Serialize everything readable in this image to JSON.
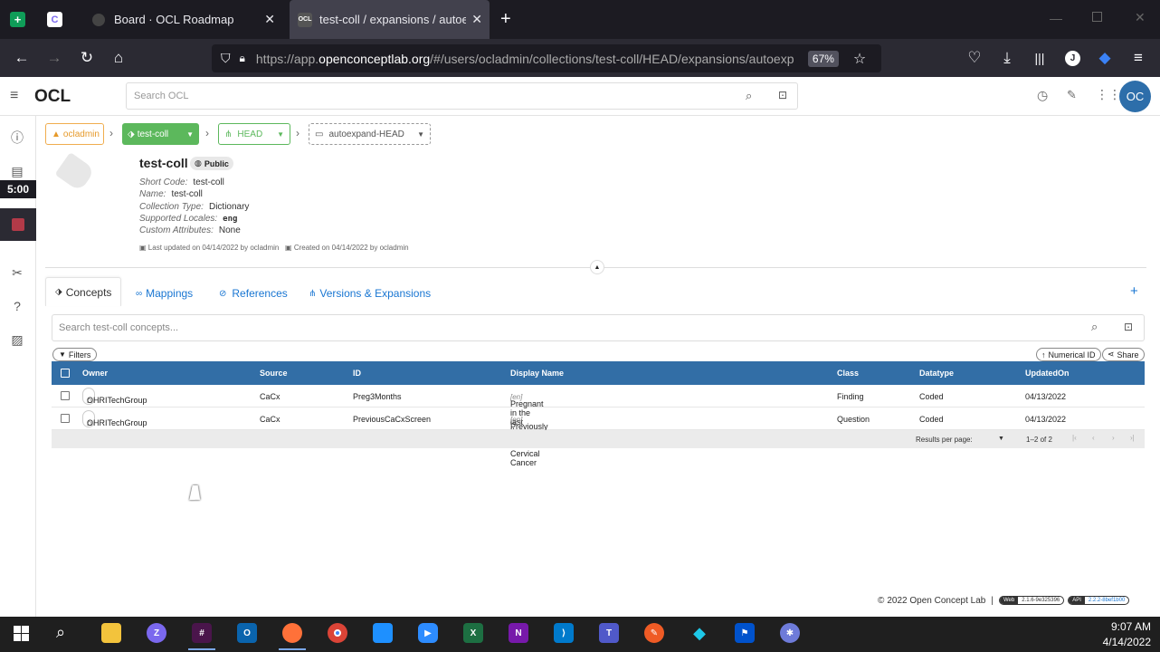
{
  "browser": {
    "tabs": [
      {
        "label": "Board · OCL Roadmap"
      },
      {
        "label": "test-coll / expansions / autoexp"
      }
    ],
    "url_prefix": "https://app.",
    "url_domain": "openconceptlab.org",
    "url_path": "/#/users/ocladmin/collections/test-coll/HEAD/expansions/autoexp",
    "zoom": "67%",
    "profile_initial": "J"
  },
  "app": {
    "logo": "OCL",
    "search_placeholder": "Search OCL",
    "avatar": "OC"
  },
  "timer": "5:00",
  "breadcrumb": {
    "owner": "ocladmin",
    "collection": "test-coll",
    "version": "HEAD",
    "expansion": "autoexpand-HEAD"
  },
  "collection": {
    "title": "test-coll",
    "visibility": "Public",
    "fields": [
      {
        "label": "Short Code:",
        "value": "test-coll"
      },
      {
        "label": "Name:",
        "value": "test-coll"
      },
      {
        "label": "Collection Type:",
        "value": "Dictionary"
      },
      {
        "label": "Supported Locales:",
        "value": "eng"
      },
      {
        "label": "Custom Attributes:",
        "value": "None"
      }
    ],
    "last_updated": "Last updated on 04/14/2022 by ocladmin",
    "created": "Created on 04/14/2022 by ocladmin"
  },
  "tabs": [
    {
      "label": "Concepts"
    },
    {
      "label": "Mappings"
    },
    {
      "label": "References"
    },
    {
      "label": "Versions & Expansions"
    }
  ],
  "concept_search_placeholder": "Search test-coll concepts...",
  "buttons": {
    "filters": "Filters",
    "numerical_id": "Numerical ID",
    "share": "Share"
  },
  "table": {
    "headers": [
      "Owner",
      "Source",
      "ID",
      "Display Name",
      "Class",
      "Datatype",
      "UpdatedOn"
    ],
    "rows": [
      {
        "owner": "OHRITechGroup",
        "source": "CaCx",
        "id": "Preg3Months",
        "name": "Pregnant in the last three months",
        "locale": "[en]",
        "class": "Finding",
        "datatype": "Coded",
        "updated": "04/13/2022"
      },
      {
        "owner": "OHRITechGroup",
        "source": "CaCx",
        "id": "PreviousCaCxScreen",
        "name": "Previously Screened for Cervical Cancer",
        "locale": "[en]",
        "class": "Question",
        "datatype": "Coded",
        "updated": "04/13/2022"
      }
    ],
    "results_per_page": "Results per page:",
    "range": "1–2 of 2"
  },
  "footer": {
    "copyright": "2022 Open Concept Lab",
    "web_label": "Web",
    "web_version": "2.1.6-9e325396",
    "api_label": "API",
    "api_version": "2.2.2-8bef1b00"
  },
  "taskbar": {
    "time": "9:07 AM",
    "date": "4/14/2022"
  },
  "colors": {
    "owner_chip": "#f0ad4e",
    "collection_chip": "#5cb85c",
    "table_header": "#326ea6",
    "link": "#1976d2",
    "avatar": "#2d6eaa"
  }
}
